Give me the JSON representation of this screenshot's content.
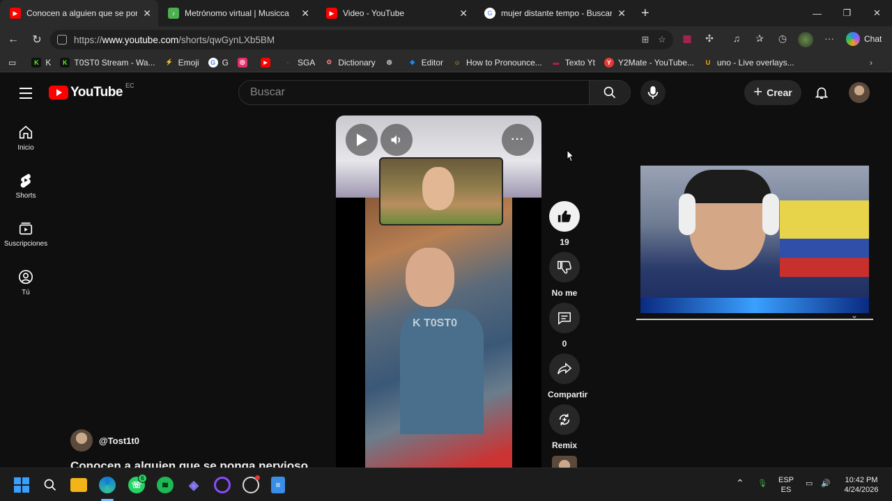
{
  "browser": {
    "tabs": [
      {
        "title": "Conocen a alguien que se ponga n",
        "favicon_color": "#ff0000",
        "favicon": "youtube-icon",
        "active": true
      },
      {
        "title": "Metrónomo virtual | Musicca",
        "favicon_color": "#4caf50",
        "favicon": "music-note-icon",
        "active": false
      },
      {
        "title": "Video - YouTube",
        "favicon_color": "#ff0000",
        "favicon": "youtube-icon",
        "active": false
      },
      {
        "title": "mujer distante tempo - Buscar cor",
        "favicon_color": "#ffffff",
        "favicon": "google-icon",
        "active": false
      }
    ],
    "url_prefix": "https://",
    "url_domain": "www.youtube.com",
    "url_path": "/shorts/qwGynLXb5BM",
    "chat_label": "Chat",
    "bookmarks": [
      {
        "label": "K",
        "color": "#53fc18",
        "icon": "K"
      },
      {
        "label": "T0ST0 Stream - Wa...",
        "color": "#53fc18",
        "icon": "K"
      },
      {
        "label": "Emoji",
        "color": "#e53935",
        "icon": "⚡"
      },
      {
        "label": "G",
        "color": "#ffffff",
        "icon": "G"
      },
      {
        "label": "",
        "color": "#e1306c",
        "icon": "◎"
      },
      {
        "label": "",
        "color": "#ff0000",
        "icon": "▶"
      },
      {
        "label": "SGA",
        "color": "#2e7d32",
        "icon": "··"
      },
      {
        "label": "Dictionary",
        "color": "#c62828",
        "icon": "✿"
      },
      {
        "label": "",
        "color": "#9e9e9e",
        "icon": "◍"
      },
      {
        "label": "Editor",
        "color": "#1e88e5",
        "icon": "◆"
      },
      {
        "label": "How to Pronounce...",
        "color": "#f9a825",
        "icon": "☺"
      },
      {
        "label": "Texto Yt",
        "color": "#c2185b",
        "icon": "▬"
      },
      {
        "label": "Y2Mate - YouTube...",
        "color": "#e53935",
        "icon": "Y"
      },
      {
        "label": "uno - Live overlays...",
        "color": "#ffb300",
        "icon": "U"
      }
    ]
  },
  "youtube": {
    "logo_text": "YouTube",
    "country_code": "EC",
    "search_placeholder": "Buscar",
    "create_label": "Crear",
    "sidebar": [
      {
        "label": "Inicio",
        "icon": "home-icon"
      },
      {
        "label": "Shorts",
        "icon": "shorts-icon"
      },
      {
        "label": "Suscripciones",
        "icon": "subscriptions-icon"
      },
      {
        "label": "Tú",
        "icon": "account-icon"
      }
    ],
    "watermark": "K T0ST0",
    "actions": {
      "like_count": "19",
      "dislike_label": "No me ...",
      "comment_count": "0",
      "share_label": "Compartir",
      "remix_label": "Remix"
    },
    "channel": "@Tost1t0",
    "title": "Conocen a alguien que se ponga nervioso"
  },
  "taskbar": {
    "whatsapp_badge": "6",
    "lang_top": "ESP",
    "lang_bottom": "ES",
    "time": "10:42 PM",
    "date": "4/24/2026"
  }
}
